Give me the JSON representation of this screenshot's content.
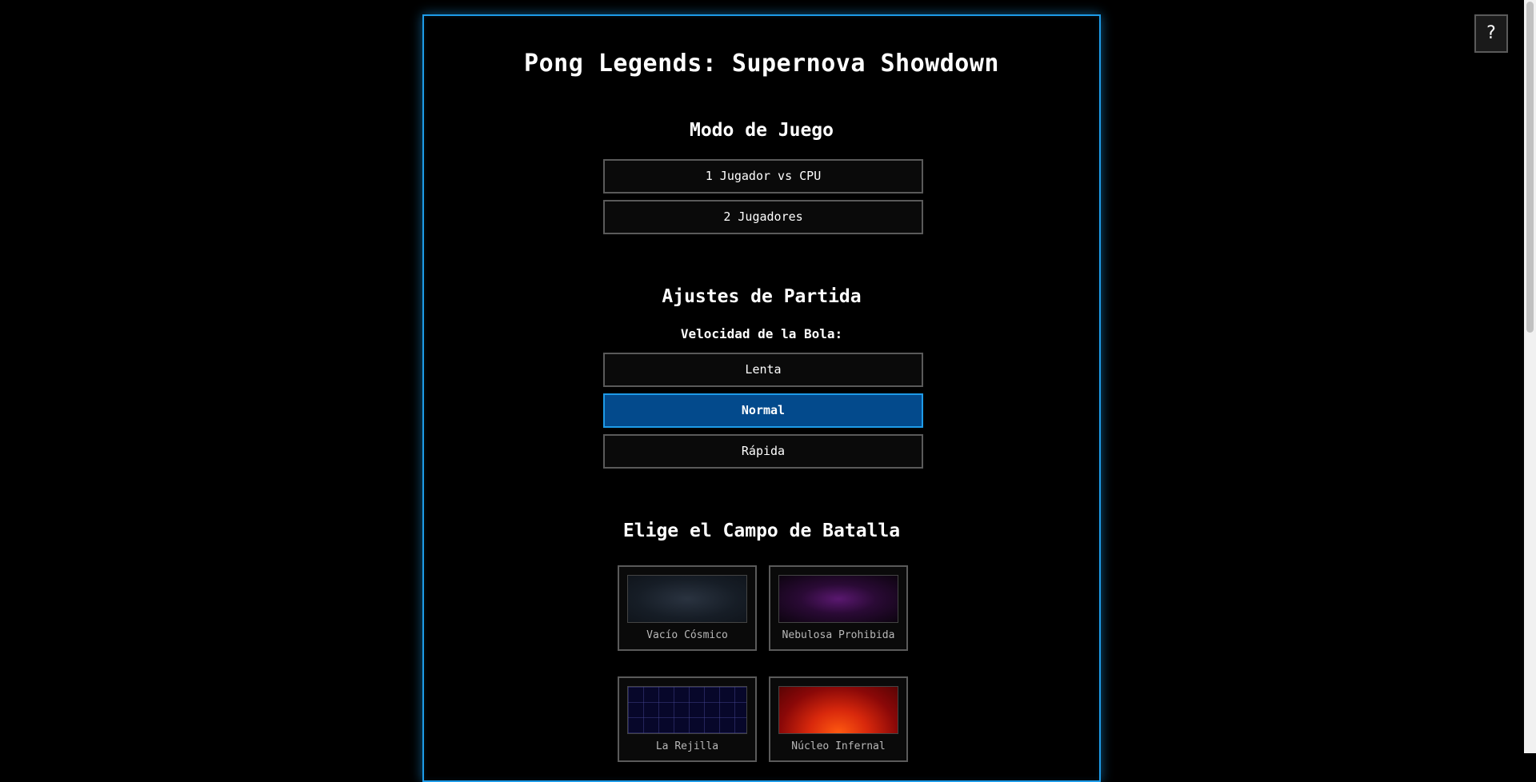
{
  "title": "Pong Legends: Supernova Showdown",
  "game_mode": {
    "heading": "Modo de Juego",
    "options": [
      "1 Jugador vs CPU",
      "2 Jugadores"
    ]
  },
  "match_settings": {
    "heading": "Ajustes de Partida",
    "speed_label": "Velocidad de la Bola:",
    "speed_options": [
      "Lenta",
      "Normal",
      "Rápida"
    ],
    "selected_speed": "Normal"
  },
  "battlefield": {
    "heading": "Elige el Campo de Batalla",
    "fields": [
      "Vacío Cósmico",
      "Nebulosa Prohibida",
      "La Rejilla",
      "Núcleo Infernal"
    ]
  },
  "help_button": "?",
  "colors": {
    "accent": "#1e9be8",
    "selected": "#034a8c",
    "background": "#000000"
  },
  "scrollbar": {
    "visible_fraction": 0.44
  }
}
